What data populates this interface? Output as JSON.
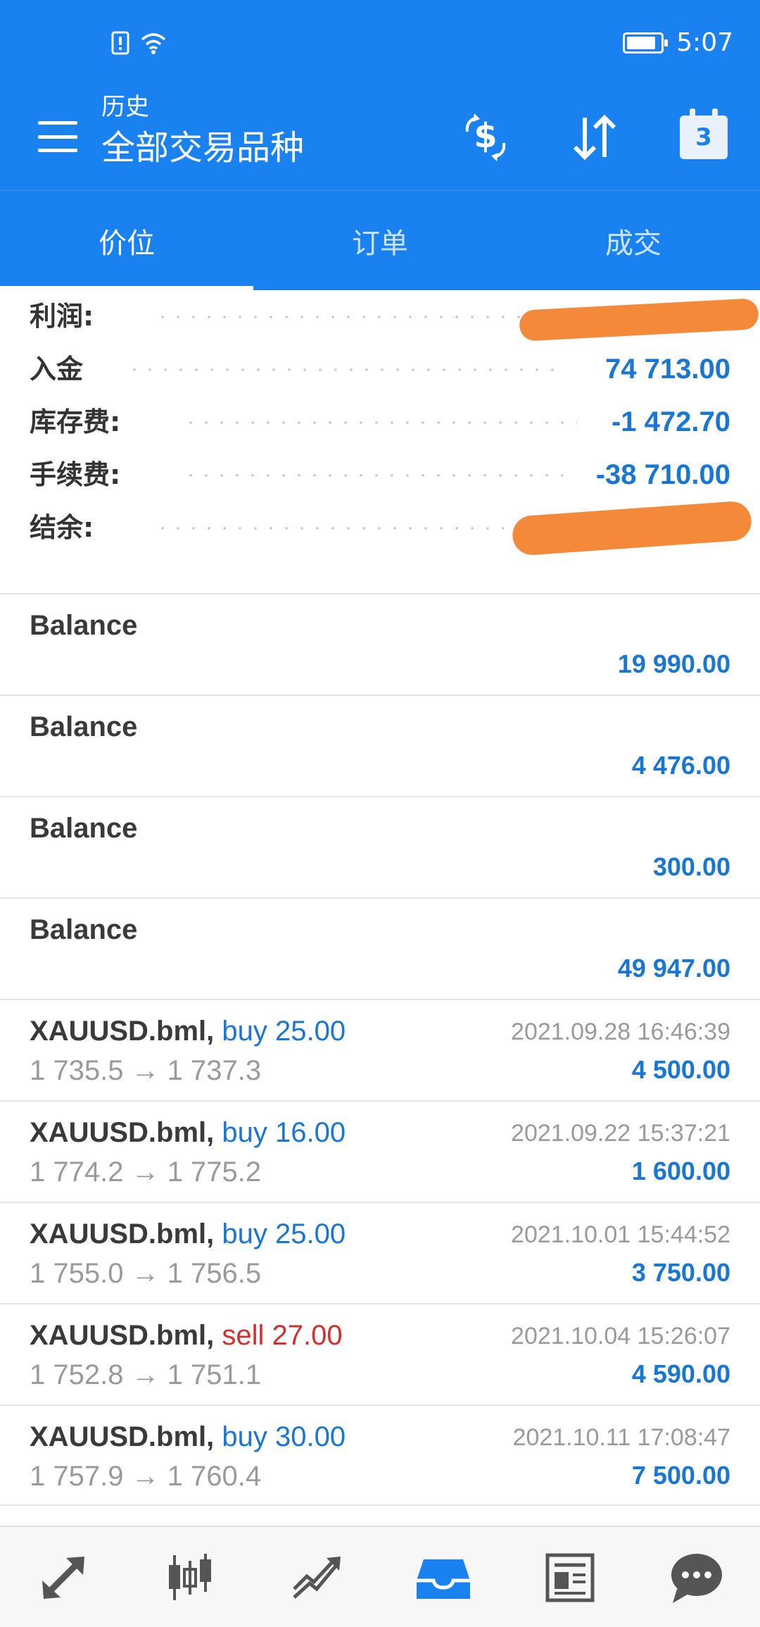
{
  "status_bar": {
    "time": "5:07"
  },
  "toolbar": {
    "subtitle": "历史",
    "title": "全部交易品种",
    "calendar_badge": "3"
  },
  "tabs": [
    {
      "label": "价位",
      "active": true
    },
    {
      "label": "订单",
      "active": false
    },
    {
      "label": "成交",
      "active": false
    }
  ],
  "summary": {
    "profit": {
      "label": "利润:",
      "value": ""
    },
    "deposit": {
      "label": "入金",
      "value": "74 713.00"
    },
    "swap": {
      "label": "库存费:",
      "value": "-1 472.70"
    },
    "commission": {
      "label": "手续费:",
      "value": "-38 710.00"
    },
    "balance": {
      "label": "结余:",
      "value": ""
    }
  },
  "balance_rows": [
    {
      "name": "Balance",
      "amount": "19 990.00"
    },
    {
      "name": "Balance",
      "amount": "4 476.00"
    },
    {
      "name": "Balance",
      "amount": "300.00"
    },
    {
      "name": "Balance",
      "amount": "49 947.00"
    }
  ],
  "deals": [
    {
      "symbol": "XAUUSD.bml,",
      "side": "buy 25.00",
      "prices": "1 735.5 → 1 737.3",
      "time": "2021.09.28 16:46:39",
      "profit": "4 500.00"
    },
    {
      "symbol": "XAUUSD.bml,",
      "side": "buy 16.00",
      "prices": "1 774.2 → 1 775.2",
      "time": "2021.09.22 15:37:21",
      "profit": "1 600.00"
    },
    {
      "symbol": "XAUUSD.bml,",
      "side": "buy 25.00",
      "prices": "1 755.0 → 1 756.5",
      "time": "2021.10.01 15:44:52",
      "profit": "3 750.00"
    },
    {
      "symbol": "XAUUSD.bml,",
      "side": "sell 27.00",
      "prices": "1 752.8 → 1 751.1",
      "time": "2021.10.04 15:26:07",
      "profit": "4 590.00"
    },
    {
      "symbol": "XAUUSD.bml,",
      "side": "buy 30.00",
      "prices": "1 757.9 → 1 760.4",
      "time": "2021.10.11 17:08:47",
      "profit": "7 500.00"
    }
  ],
  "colors": {
    "header_bg": "#1a82f0",
    "value_blue": "#1976d2",
    "sell_red": "#d32f2f",
    "redaction_orange": "#f5893a"
  },
  "bottom_nav": [
    {
      "icon": "quotes-icon"
    },
    {
      "icon": "chart-icon"
    },
    {
      "icon": "trade-icon"
    },
    {
      "icon": "history-icon",
      "active": true
    },
    {
      "icon": "news-icon"
    },
    {
      "icon": "messages-icon"
    }
  ]
}
